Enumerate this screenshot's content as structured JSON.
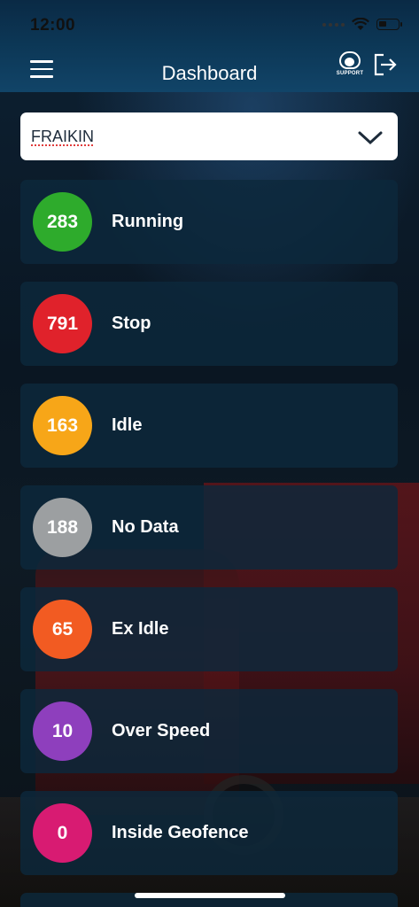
{
  "status_bar": {
    "time": "12:00"
  },
  "header": {
    "title": "Dashboard",
    "support_label": "SUPPORT"
  },
  "filter": {
    "selected": "FRAIKIN"
  },
  "cards": [
    {
      "count": "283",
      "label": "Running",
      "color": "#2eab2c"
    },
    {
      "count": "791",
      "label": "Stop",
      "color": "#e0222b"
    },
    {
      "count": "163",
      "label": "Idle",
      "color": "#f7a618"
    },
    {
      "count": "188",
      "label": "No Data",
      "color": "#9c9fa1"
    },
    {
      "count": "65",
      "label": "Ex Idle",
      "color": "#f25b22"
    },
    {
      "count": "10",
      "label": "Over Speed",
      "color": "#8e3fbd"
    },
    {
      "count": "0",
      "label": "Inside Geofence",
      "color": "#d81b72"
    }
  ]
}
